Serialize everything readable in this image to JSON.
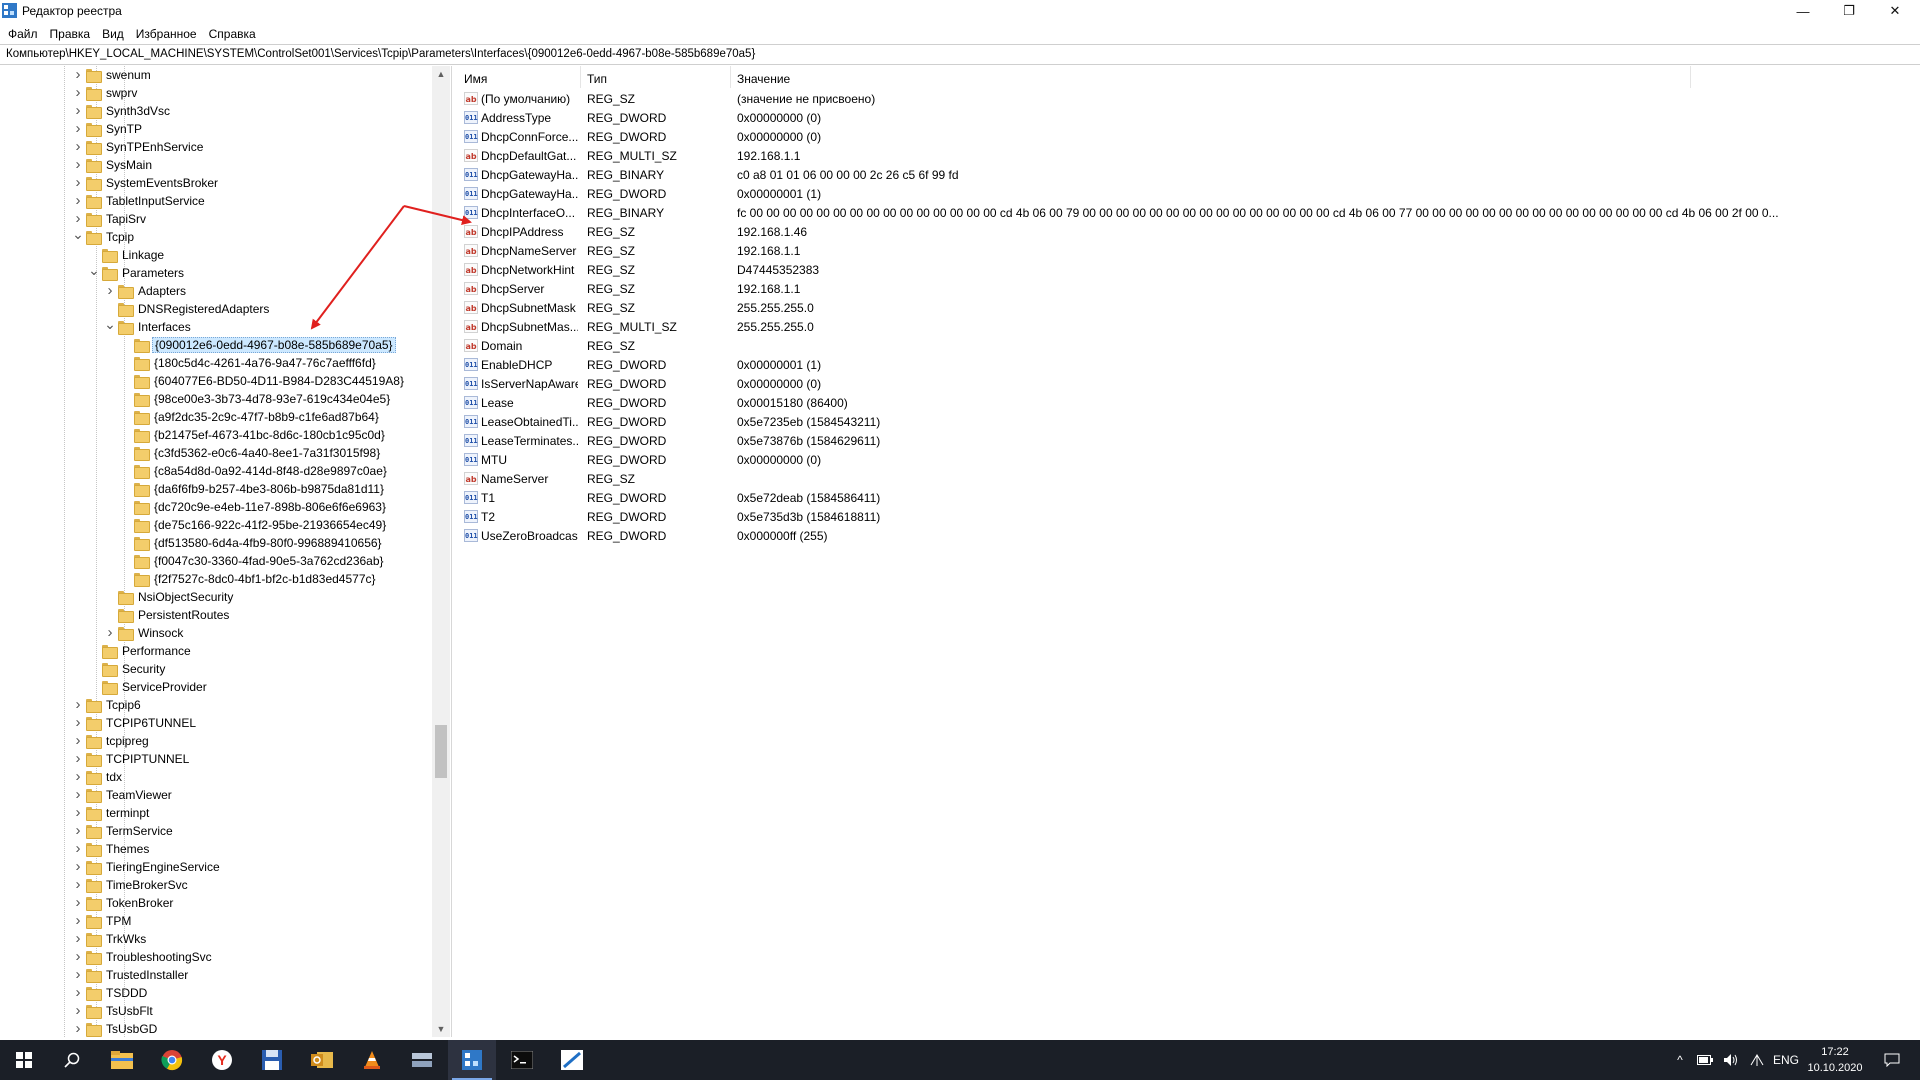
{
  "window": {
    "title": "Редактор реестра",
    "min_glyph": "—",
    "restore_glyph": "❐",
    "close_glyph": "✕"
  },
  "menu": [
    "Файл",
    "Правка",
    "Вид",
    "Избранное",
    "Справка"
  ],
  "address": "Компьютер\\HKEY_LOCAL_MACHINE\\SYSTEM\\ControlSet001\\Services\\Tcpip\\Parameters\\Interfaces\\{090012e6-0edd-4967-b08e-585b689e70a5}",
  "tree": [
    {
      "label": "swenum",
      "level": 0,
      "expander": "collapsed"
    },
    {
      "label": "swprv",
      "level": 0,
      "expander": "collapsed"
    },
    {
      "label": "Synth3dVsc",
      "level": 0,
      "expander": "collapsed"
    },
    {
      "label": "SynTP",
      "level": 0,
      "expander": "collapsed"
    },
    {
      "label": "SynTPEnhService",
      "level": 0,
      "expander": "collapsed"
    },
    {
      "label": "SysMain",
      "level": 0,
      "expander": "collapsed"
    },
    {
      "label": "SystemEventsBroker",
      "level": 0,
      "expander": "collapsed"
    },
    {
      "label": "TabletInputService",
      "level": 0,
      "expander": "collapsed"
    },
    {
      "label": "TapiSrv",
      "level": 0,
      "expander": "collapsed"
    },
    {
      "label": "Tcpip",
      "level": 0,
      "expander": "expanded"
    },
    {
      "label": "Linkage",
      "level": 1,
      "expander": "none"
    },
    {
      "label": "Parameters",
      "level": 1,
      "expander": "expanded"
    },
    {
      "label": "Adapters",
      "level": 2,
      "expander": "collapsed"
    },
    {
      "label": "DNSRegisteredAdapters",
      "level": 2,
      "expander": "none"
    },
    {
      "label": "Interfaces",
      "level": 2,
      "expander": "expanded"
    },
    {
      "label": "{090012e6-0edd-4967-b08e-585b689e70a5}",
      "level": 3,
      "expander": "none",
      "selected": true
    },
    {
      "label": "{180c5d4c-4261-4a76-9a47-76c7aefff6fd}",
      "level": 3,
      "expander": "none"
    },
    {
      "label": "{604077E6-BD50-4D11-B984-D283C44519A8}",
      "level": 3,
      "expander": "none"
    },
    {
      "label": "{98ce00e3-3b73-4d78-93e7-619c434e04e5}",
      "level": 3,
      "expander": "none"
    },
    {
      "label": "{a9f2dc35-2c9c-47f7-b8b9-c1fe6ad87b64}",
      "level": 3,
      "expander": "none"
    },
    {
      "label": "{b21475ef-4673-41bc-8d6c-180cb1c95c0d}",
      "level": 3,
      "expander": "none"
    },
    {
      "label": "{c3fd5362-e0c6-4a40-8ee1-7a31f3015f98}",
      "level": 3,
      "expander": "none"
    },
    {
      "label": "{c8a54d8d-0a92-414d-8f48-d28e9897c0ae}",
      "level": 3,
      "expander": "none"
    },
    {
      "label": "{da6f6fb9-b257-4be3-806b-b9875da81d11}",
      "level": 3,
      "expander": "none"
    },
    {
      "label": "{dc720c9e-e4eb-11e7-898b-806e6f6e6963}",
      "level": 3,
      "expander": "none"
    },
    {
      "label": "{de75c166-922c-41f2-95be-21936654ec49}",
      "level": 3,
      "expander": "none"
    },
    {
      "label": "{df513580-6d4a-4fb9-80f0-996889410656}",
      "level": 3,
      "expander": "none"
    },
    {
      "label": "{f0047c30-3360-4fad-90e5-3a762cd236ab}",
      "level": 3,
      "expander": "none"
    },
    {
      "label": "{f2f7527c-8dc0-4bf1-bf2c-b1d83ed4577c}",
      "level": 3,
      "expander": "none"
    },
    {
      "label": "NsiObjectSecurity",
      "level": 2,
      "expander": "none"
    },
    {
      "label": "PersistentRoutes",
      "level": 2,
      "expander": "none"
    },
    {
      "label": "Winsock",
      "level": 2,
      "expander": "collapsed"
    },
    {
      "label": "Performance",
      "level": 1,
      "expander": "none"
    },
    {
      "label": "Security",
      "level": 1,
      "expander": "none"
    },
    {
      "label": "ServiceProvider",
      "level": 1,
      "expander": "none"
    },
    {
      "label": "Tcpip6",
      "level": 0,
      "expander": "collapsed"
    },
    {
      "label": "TCPIP6TUNNEL",
      "level": 0,
      "expander": "collapsed"
    },
    {
      "label": "tcpipreg",
      "level": 0,
      "expander": "collapsed"
    },
    {
      "label": "TCPIPTUNNEL",
      "level": 0,
      "expander": "collapsed"
    },
    {
      "label": "tdx",
      "level": 0,
      "expander": "collapsed"
    },
    {
      "label": "TeamViewer",
      "level": 0,
      "expander": "collapsed"
    },
    {
      "label": "terminpt",
      "level": 0,
      "expander": "collapsed"
    },
    {
      "label": "TermService",
      "level": 0,
      "expander": "collapsed"
    },
    {
      "label": "Themes",
      "level": 0,
      "expander": "collapsed"
    },
    {
      "label": "TieringEngineService",
      "level": 0,
      "expander": "collapsed"
    },
    {
      "label": "TimeBrokerSvc",
      "level": 0,
      "expander": "collapsed"
    },
    {
      "label": "TokenBroker",
      "level": 0,
      "expander": "collapsed"
    },
    {
      "label": "TPM",
      "level": 0,
      "expander": "collapsed"
    },
    {
      "label": "TrkWks",
      "level": 0,
      "expander": "collapsed"
    },
    {
      "label": "TroubleshootingSvc",
      "level": 0,
      "expander": "collapsed"
    },
    {
      "label": "TrustedInstaller",
      "level": 0,
      "expander": "collapsed"
    },
    {
      "label": "TSDDD",
      "level": 0,
      "expander": "collapsed"
    },
    {
      "label": "TsUsbFlt",
      "level": 0,
      "expander": "collapsed"
    },
    {
      "label": "TsUsbGD",
      "level": 0,
      "expander": "collapsed"
    }
  ],
  "columns": [
    "Имя",
    "Тип",
    "Значение"
  ],
  "values": [
    {
      "icon": "string-value-icon",
      "name": "(По умолчанию)",
      "type": "REG_SZ",
      "data": "(значение не присвоено)"
    },
    {
      "icon": "binary-value-icon",
      "name": "AddressType",
      "type": "REG_DWORD",
      "data": "0x00000000 (0)"
    },
    {
      "icon": "binary-value-icon",
      "name": "DhcpConnForce...",
      "type": "REG_DWORD",
      "data": "0x00000000 (0)"
    },
    {
      "icon": "string-value-icon",
      "name": "DhcpDefaultGat...",
      "type": "REG_MULTI_SZ",
      "data": "192.168.1.1"
    },
    {
      "icon": "binary-value-icon",
      "name": "DhcpGatewayHa...",
      "type": "REG_BINARY",
      "data": "c0 a8 01 01 06 00 00 00 2c 26 c5 6f 99 fd"
    },
    {
      "icon": "binary-value-icon",
      "name": "DhcpGatewayHa...",
      "type": "REG_DWORD",
      "data": "0x00000001 (1)"
    },
    {
      "icon": "binary-value-icon",
      "name": "DhcpInterfaceO...",
      "type": "REG_BINARY",
      "data": "fc 00 00 00 00 00 00 00 00 00 00 00 00 00 00 00 cd 4b 06 00 79 00 00 00 00 00 00 00 00 00 00 00 00 00 00 00 cd 4b 06 00 77 00 00 00 00 00 00 00 00 00 00 00 00 00 00 00 cd 4b 06 00 2f 00 0..."
    },
    {
      "icon": "string-value-icon",
      "name": "DhcpIPAddress",
      "type": "REG_SZ",
      "data": "192.168.1.46"
    },
    {
      "icon": "string-value-icon",
      "name": "DhcpNameServer",
      "type": "REG_SZ",
      "data": "192.168.1.1"
    },
    {
      "icon": "string-value-icon",
      "name": "DhcpNetworkHint",
      "type": "REG_SZ",
      "data": "D47445352383"
    },
    {
      "icon": "string-value-icon",
      "name": "DhcpServer",
      "type": "REG_SZ",
      "data": "192.168.1.1"
    },
    {
      "icon": "string-value-icon",
      "name": "DhcpSubnetMask",
      "type": "REG_SZ",
      "data": "255.255.255.0"
    },
    {
      "icon": "string-value-icon",
      "name": "DhcpSubnetMas...",
      "type": "REG_MULTI_SZ",
      "data": "255.255.255.0"
    },
    {
      "icon": "string-value-icon",
      "name": "Domain",
      "type": "REG_SZ",
      "data": ""
    },
    {
      "icon": "binary-value-icon",
      "name": "EnableDHCP",
      "type": "REG_DWORD",
      "data": "0x00000001 (1)"
    },
    {
      "icon": "binary-value-icon",
      "name": "IsServerNapAware",
      "type": "REG_DWORD",
      "data": "0x00000000 (0)"
    },
    {
      "icon": "binary-value-icon",
      "name": "Lease",
      "type": "REG_DWORD",
      "data": "0x00015180 (86400)"
    },
    {
      "icon": "binary-value-icon",
      "name": "LeaseObtainedTi...",
      "type": "REG_DWORD",
      "data": "0x5e7235eb (1584543211)"
    },
    {
      "icon": "binary-value-icon",
      "name": "LeaseTerminates...",
      "type": "REG_DWORD",
      "data": "0x5e73876b (1584629611)"
    },
    {
      "icon": "binary-value-icon",
      "name": "MTU",
      "type": "REG_DWORD",
      "data": "0x00000000 (0)"
    },
    {
      "icon": "string-value-icon",
      "name": "NameServer",
      "type": "REG_SZ",
      "data": ""
    },
    {
      "icon": "binary-value-icon",
      "name": "T1",
      "type": "REG_DWORD",
      "data": "0x5e72deab (1584586411)"
    },
    {
      "icon": "binary-value-icon",
      "name": "T2",
      "type": "REG_DWORD",
      "data": "0x5e735d3b (1584618811)"
    },
    {
      "icon": "binary-value-icon",
      "name": "UseZeroBroadcast",
      "type": "REG_DWORD",
      "data": "0x000000ff (255)"
    }
  ],
  "taskbar": {
    "apps": [
      {
        "name": "start-button",
        "active": false
      },
      {
        "name": "search-button",
        "active": false
      },
      {
        "name": "file-explorer-app",
        "active": false
      },
      {
        "name": "chrome-app",
        "active": false
      },
      {
        "name": "yandex-browser-app",
        "active": false
      },
      {
        "name": "save-disk-app",
        "active": false
      },
      {
        "name": "outlook-app",
        "active": false
      },
      {
        "name": "vlc-app",
        "active": false
      },
      {
        "name": "server-app",
        "active": false
      },
      {
        "name": "registry-editor-app",
        "active": true
      },
      {
        "name": "terminal-app",
        "active": false
      },
      {
        "name": "network-app",
        "active": false
      }
    ],
    "language": "ENG",
    "time": "17:22",
    "date": "10.10.2020"
  },
  "colors": {
    "selection": "#cce8ff",
    "annotation_arrow": "#e0201e",
    "taskbar": "#1b1f27"
  }
}
